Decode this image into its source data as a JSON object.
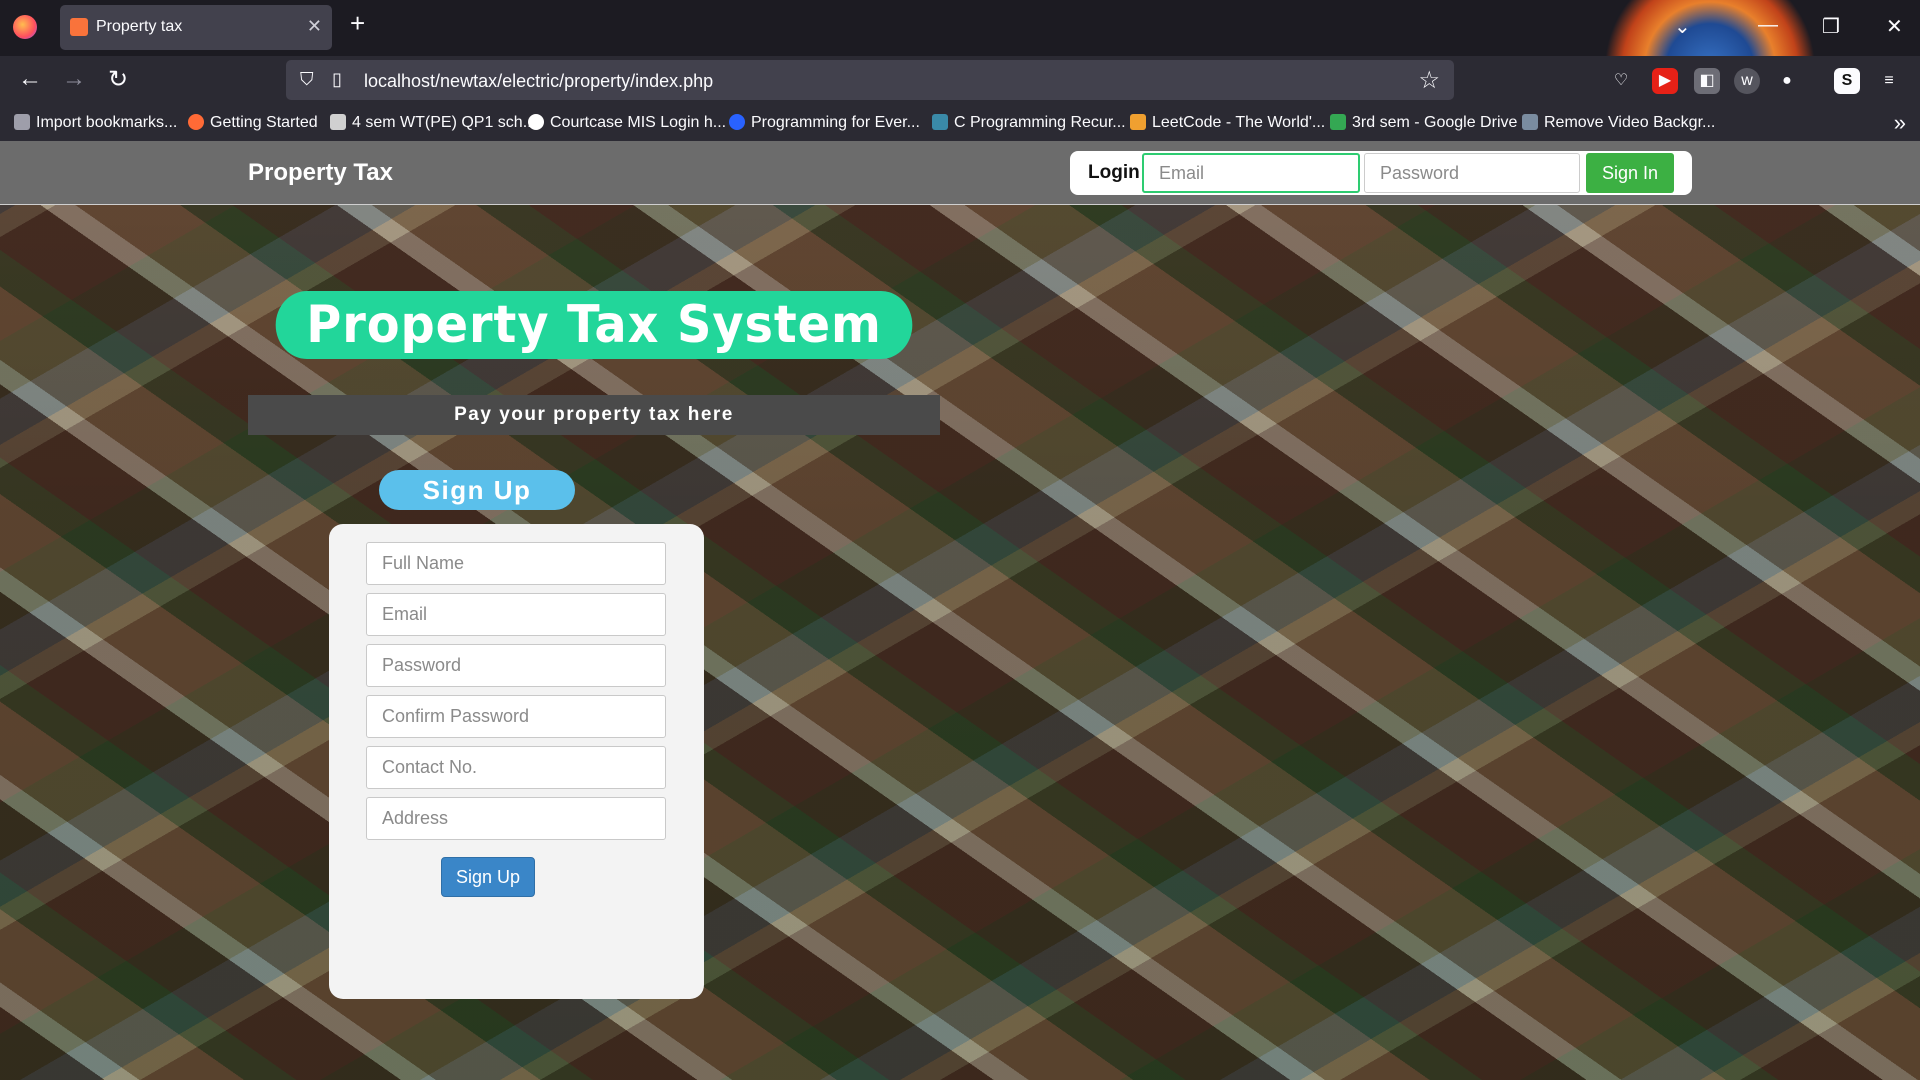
{
  "browser": {
    "tab_title": "Property tax",
    "url": "localhost/newtax/electric/property/index.php",
    "bookmarks": [
      "Import bookmarks...",
      "Getting Started",
      "4 sem WT(PE) QP1 sch...",
      "Courtcase MIS Login h...",
      "Programming for Ever...",
      "C Programming Recur...",
      "LeetCode - The World'...",
      "3rd sem - Google Drive",
      "Remove Video Backgr..."
    ]
  },
  "header": {
    "brand": "Property Tax",
    "login_label": "Login",
    "email_placeholder": "Email",
    "password_placeholder": "Password",
    "signin_label": "Sign In"
  },
  "hero": {
    "title": "Property Tax System",
    "subtitle": "Pay your property tax here"
  },
  "signup": {
    "heading": "Sign Up",
    "fields": [
      "Full Name",
      "Email",
      "Password",
      "Confirm Password",
      "Contact No.",
      "Address"
    ],
    "button_label": "Sign Up"
  },
  "colors": {
    "hero_title_bg": "#22d69a",
    "signup_pill_bg": "#5bc0eb",
    "signin_button_bg": "#3cb043",
    "signup_button_bg": "#3a86c8",
    "header_bg": "#6c6c6c"
  }
}
